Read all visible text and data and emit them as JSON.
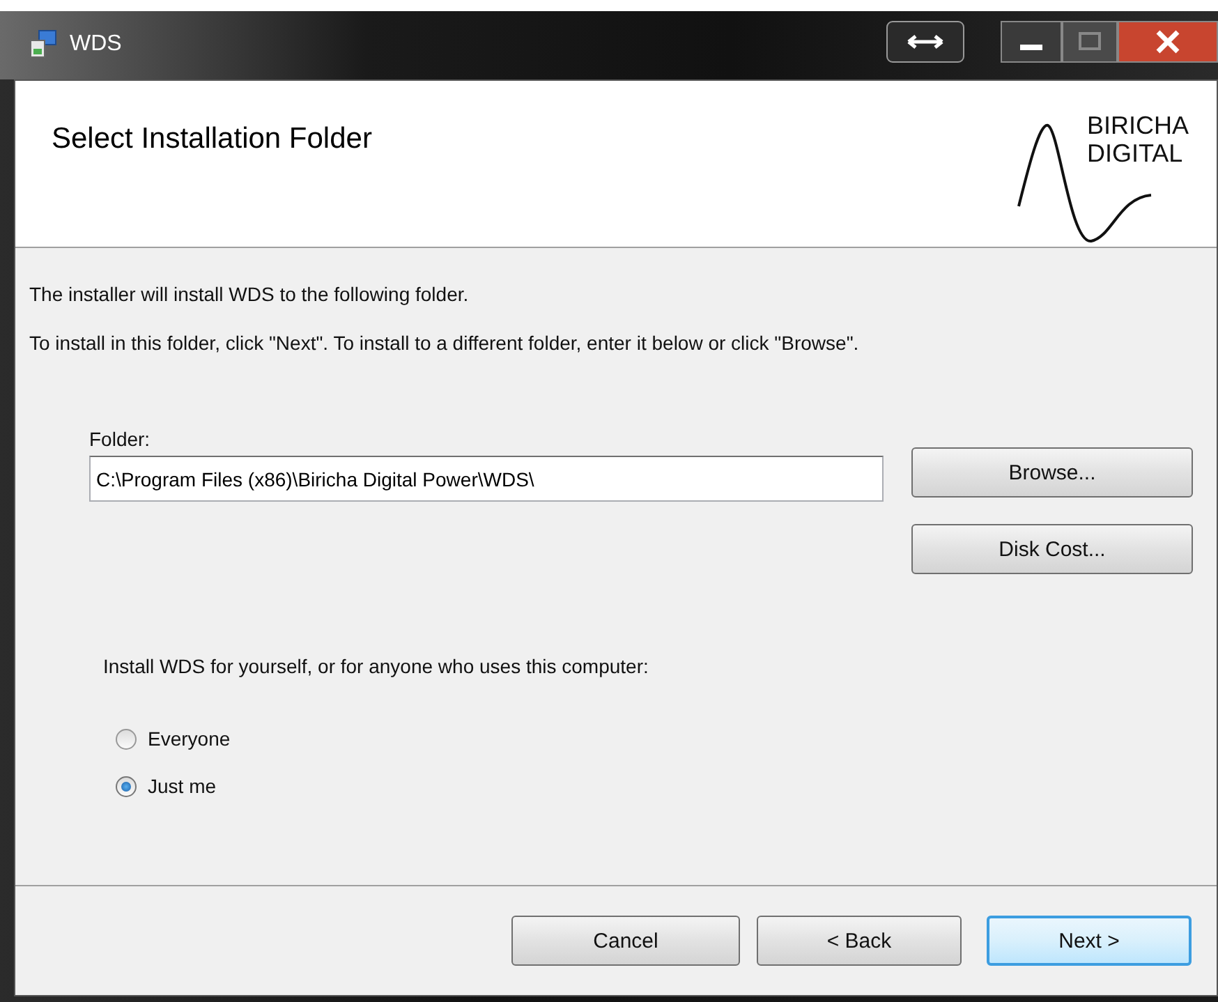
{
  "window": {
    "title": "WDS"
  },
  "header": {
    "title": "Select Installation Folder",
    "logo_lines": [
      "BIRICHA",
      "DIGITAL"
    ]
  },
  "intro": [
    "The installer will install WDS to the following folder.",
    "To install in this folder, click \"Next\". To install to a different folder, enter it below or click \"Browse\"."
  ],
  "folder": {
    "label": "Folder:",
    "value": "C:\\Program Files (x86)\\Biricha Digital Power\\WDS\\"
  },
  "side_buttons": [
    "Browse...",
    "Disk Cost..."
  ],
  "scope": {
    "prompt": "Install WDS for yourself, or for anyone who uses this computer:",
    "options": [
      {
        "label": "Everyone",
        "selected": false
      },
      {
        "label": "Just me",
        "selected": true
      }
    ]
  },
  "buttons": [
    {
      "label": "Cancel",
      "default": false
    },
    {
      "label": "< Back",
      "default": false
    },
    {
      "label": "Next >",
      "default": true
    }
  ]
}
